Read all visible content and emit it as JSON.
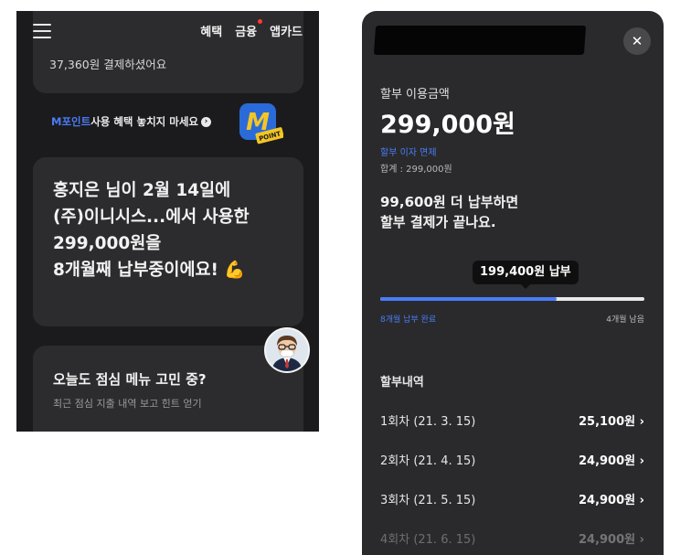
{
  "left": {
    "nav": [
      "혜택",
      "금융",
      "앱카드"
    ],
    "top_card_text": "37,360원 결제하셨어요",
    "promo": {
      "highlight": "M포인트",
      "rest": " 사용 혜택 놓치지 마세요",
      "arrow": "›"
    },
    "mpoint_badge": {
      "letter": "M",
      "word": "POINT"
    },
    "main_message": "홍지은 님이 2월 14일에\n(주)이니시스...에서 사용한\n299,000원을\n8개월째 납부중이에요! 💪",
    "lunch_title": "오늘도 점심 메뉴 고민 중?",
    "lunch_sub": "최근 점심 지출 내역 보고 힌트 얻기"
  },
  "right": {
    "close": "✕",
    "label": "할부 이용금액",
    "amount": "299,000원",
    "interest_free": "할부 이자 면제",
    "total": "합계 : 299,000원",
    "remaining_message": "99,600원 더 납부하면\n할부 결제가 끝나요.",
    "paid_tooltip": "199,400원 납부",
    "progress_fraction": 0.667,
    "progress_left": "8개월 납부 완료",
    "progress_right": "4개월 남음",
    "history_title": "할부내역",
    "history": [
      {
        "label": "1회차 (21. 3. 15)",
        "amount": "25,100원 ›"
      },
      {
        "label": "2회차 (21. 4. 15)",
        "amount": "24,900원 ›"
      },
      {
        "label": "3회차 (21. 5. 15)",
        "amount": "24,900원 ›"
      },
      {
        "label": "4회차 (21. 6. 15)",
        "amount": "24,900원 ›"
      }
    ]
  },
  "colors": {
    "accent": "#4b7bf5",
    "background": "#1b1b1d",
    "card": "#2c2c2e",
    "badge": "#2a6bd9",
    "badge_tag": "#f3c624"
  }
}
